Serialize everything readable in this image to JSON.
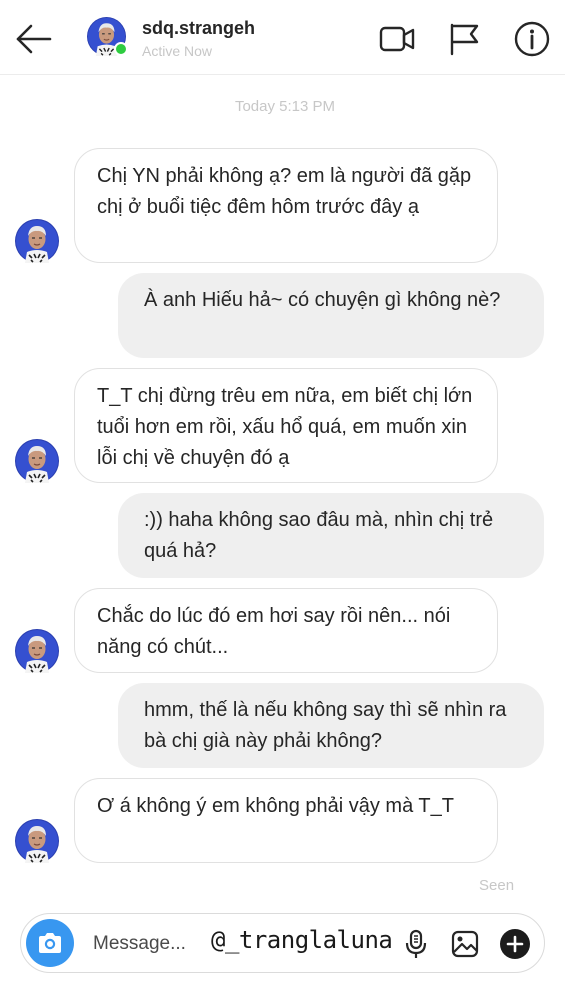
{
  "header": {
    "username": "sdq.strangeh",
    "status": "Active Now",
    "icons": [
      "back-arrow-icon",
      "video-call-icon",
      "flag-icon",
      "info-icon"
    ]
  },
  "conversation": {
    "timestamp": "Today 5:13 PM",
    "messages": [
      {
        "direction": "in",
        "text": "Chị YN phải không ạ? em là người đã gặp chị ở buổi tiệc đêm hôm trước đây ạ"
      },
      {
        "direction": "out",
        "text": "À anh Hiếu hả~ có chuyện gì không nè?"
      },
      {
        "direction": "in",
        "text": "T_T chị đừng trêu em nữa, em biết chị lớn tuổi hơn em rồi, xấu hổ quá, em muốn xin lỗi chị về chuyện đó ạ"
      },
      {
        "direction": "out",
        "text": ":)) haha không sao đâu mà, nhìn chị trẻ quá hả?"
      },
      {
        "direction": "in",
        "text": "Chắc do lúc đó em hơi say rồi nên... nói năng có chút..."
      },
      {
        "direction": "out",
        "text": "hmm, thế là nếu không say thì sẽ nhìn ra bà chị già này phải không?"
      },
      {
        "direction": "in",
        "text": "Ơ á không ý em không phải vậy mà T_T"
      }
    ],
    "seen_label": "Seen"
  },
  "composer": {
    "placeholder": "Message...",
    "watermark": "@_tranglaluna",
    "icons": [
      "camera-icon",
      "microphone-icon",
      "gallery-icon",
      "plus-icon"
    ]
  },
  "colors": {
    "accent": "#3897f0",
    "online": "#2ecc40",
    "outgoing_bubble": "#efefef",
    "muted_text": "#c7c7c7"
  }
}
